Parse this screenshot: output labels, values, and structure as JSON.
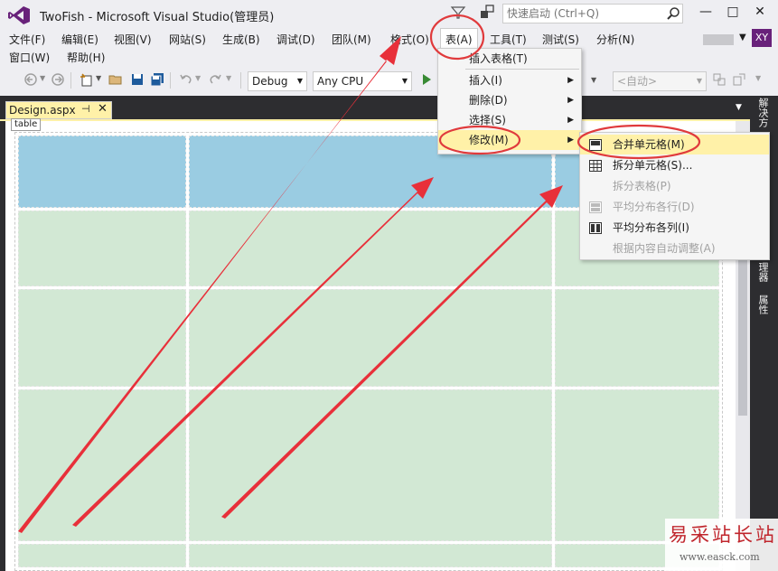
{
  "app": {
    "title": "TwoFish - Microsoft Visual Studio(管理员)",
    "quick_launch_placeholder": "快速启动 (Ctrl+Q)",
    "user_initials": "XY",
    "window_buttons": [
      "—",
      "□",
      "✕"
    ]
  },
  "menubar": {
    "row1": [
      "文件(F)",
      "编辑(E)",
      "视图(V)",
      "网站(S)",
      "生成(B)",
      "调试(D)",
      "团队(M)",
      "格式(O)",
      "表(A)",
      "工具(T)",
      "测试(S)",
      "分析(N)"
    ],
    "row2": [
      "窗口(W)",
      "帮助(H)"
    ],
    "active": "表(A)"
  },
  "toolbar": {
    "config": "Debug",
    "platform": "Any CPU",
    "auto": "<自动>"
  },
  "document": {
    "tab_name": "Design.aspx",
    "table_tag": "table"
  },
  "side_panel": {
    "labels": [
      "解决方",
      "理器",
      "属性"
    ]
  },
  "table_menu": {
    "items": [
      {
        "label": "插入表格(T)",
        "submenu": false
      },
      {
        "label": "插入(I)",
        "submenu": true
      },
      {
        "label": "删除(D)",
        "submenu": true
      },
      {
        "label": "选择(S)",
        "submenu": true
      },
      {
        "label": "修改(M)",
        "submenu": true,
        "highlighted": true
      }
    ]
  },
  "modify_submenu": {
    "items": [
      {
        "label": "合并单元格(M)",
        "icon": "merge-cells-icon",
        "enabled": true,
        "highlighted": true
      },
      {
        "label": "拆分单元格(S)...",
        "icon": "split-cells-icon",
        "enabled": true
      },
      {
        "label": "拆分表格(P)",
        "icon": "",
        "enabled": false
      },
      {
        "label": "平均分布各行(D)",
        "icon": "distribute-rows-icon",
        "enabled": false
      },
      {
        "label": "平均分布各列(I)",
        "icon": "distribute-columns-icon",
        "enabled": true
      },
      {
        "label": "根据内容自动调整(A)",
        "icon": "",
        "enabled": false
      }
    ]
  },
  "colors": {
    "vs_purple": "#68217a",
    "tab_yellow": "#fff1a8",
    "selected_cell": "#9acce2",
    "cell": "#d2e8d4",
    "annotation_red": "#e8303a"
  },
  "watermark": {
    "cn": "易采站长站",
    "url": "www.easck.com"
  }
}
